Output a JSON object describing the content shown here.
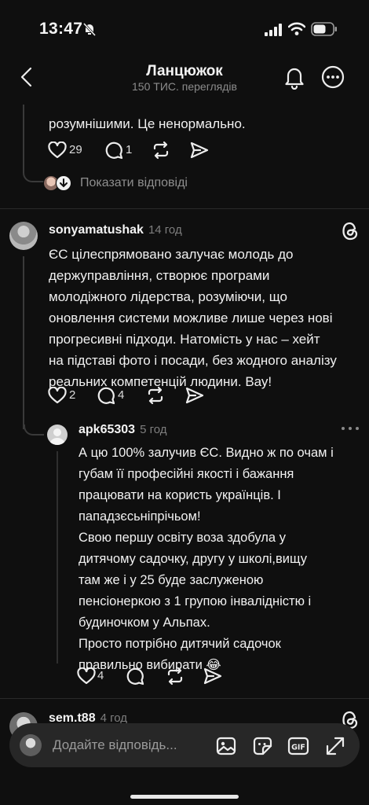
{
  "status_bar": {
    "time": "13:47"
  },
  "header": {
    "title": "Ланцюжок",
    "subtitle": "150 ТИС. переглядів"
  },
  "prev_comment": {
    "partial_line": "розумнішими. Це ненормально.",
    "likes": "29",
    "replies": "1",
    "show_replies": "Показати відповіді"
  },
  "comment1": {
    "username": "sonyamatushak",
    "time": "14 год",
    "lines": [
      "ЄС цілеспрямовано залучає молодь до",
      "держуправління, створює програми",
      "молодіжного лідерства, розуміючи, що",
      "оновлення системи можливе лише через нові",
      "прогресивні підходи. Натомість у нас – хейт",
      "на підставі фото і посади, без жодного аналізу",
      "реальних компетенцій людини. Вау!"
    ],
    "likes": "2",
    "replies": "4"
  },
  "reply1": {
    "username": "apk65303",
    "time": "5 год",
    "lines": [
      "А цю 100% залучив ЄС. Видно ж по очам і",
      "губам її професійні якості і бажання",
      "працювати на користь українців. І",
      "пападзєсьніпрічьом!",
      "Свою першу освіту воза здобула у",
      "дитячому садочку, другу у школі,вищу",
      "там же і у 25 буде заслуженою",
      "пенсіонеркою з 1 групою інвалідністю і",
      "будиночком у Альпах.",
      "Просто потрібно дитячий садочок",
      "правильно вибирати 😂"
    ],
    "likes": "4"
  },
  "comment2": {
    "username": "sem.t88",
    "time": "4 год"
  },
  "reply_bar": {
    "placeholder": "Додайте відповідь..."
  },
  "icons": [
    "back-chevron-icon",
    "bell-icon",
    "more-icon",
    "heart-icon",
    "comment-icon",
    "repost-icon",
    "share-icon",
    "threads-logo-icon",
    "image-icon",
    "sticker-icon",
    "gif-icon",
    "expand-icon"
  ]
}
